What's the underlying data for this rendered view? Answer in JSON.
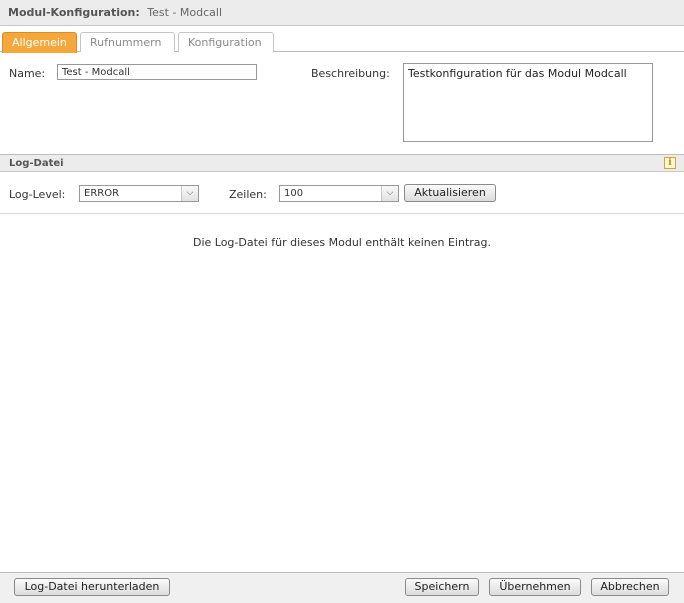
{
  "titlebar": {
    "label": "Modul-Konfiguration:",
    "name": "Test - Modcall"
  },
  "tabs": [
    {
      "label": "Allgemein",
      "active": true
    },
    {
      "label": "Rufnummern",
      "active": false
    },
    {
      "label": "Konfiguration",
      "active": false
    }
  ],
  "general": {
    "name_label": "Name:",
    "name_value": "Test - Modcall",
    "description_label": "Beschreibung:",
    "description_value": "Testkonfiguration für das Modul Modcall"
  },
  "log": {
    "section_title": "Log-Datei",
    "info_icon": "info-icon",
    "level_label": "Log-Level:",
    "level_value": "ERROR",
    "lines_label": "Zeilen:",
    "lines_value": "100",
    "refresh_label": "Aktualisieren",
    "empty_message": "Die Log-Datei für dieses Modul enthält keinen Eintrag."
  },
  "footer": {
    "download_label": "Log-Datei herunterladen",
    "save_label": "Speichern",
    "apply_label": "Übernehmen",
    "cancel_label": "Abbrechen"
  },
  "colors": {
    "active_tab": "#f4a83c",
    "header_bg": "#ececec"
  }
}
